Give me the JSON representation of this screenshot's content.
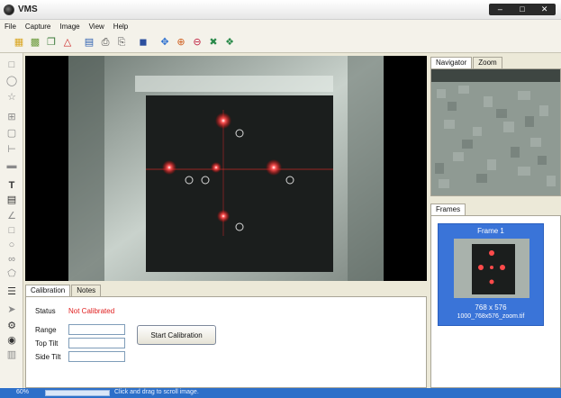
{
  "window": {
    "title": "VMS"
  },
  "menu": {
    "items": [
      "File",
      "Capture",
      "Image",
      "View",
      "Help"
    ]
  },
  "navigator": {
    "tabs": [
      "Navigator",
      "Zoom"
    ]
  },
  "frames": {
    "tab": "Frames",
    "items": [
      {
        "name": "Frame 1",
        "resolution": "768 x 576",
        "file": "1000_768x576_zoom.tif"
      }
    ]
  },
  "bottom": {
    "tabs": [
      "Calibration",
      "Notes"
    ],
    "status_label": "Status",
    "status_value": "Not Calibrated",
    "status_color": "#e02020",
    "range_label": "Range",
    "top_tilt_label": "Top Tilt",
    "side_tilt_label": "Side Tilt",
    "start_button": "Start Calibration"
  },
  "statusbar": {
    "zoom": "60%",
    "message": "Click and drag to scroll image."
  },
  "colors": {
    "accent": "#3a74d8",
    "statusbar": "#2c6fc9",
    "laser": "#ff3b3b"
  }
}
